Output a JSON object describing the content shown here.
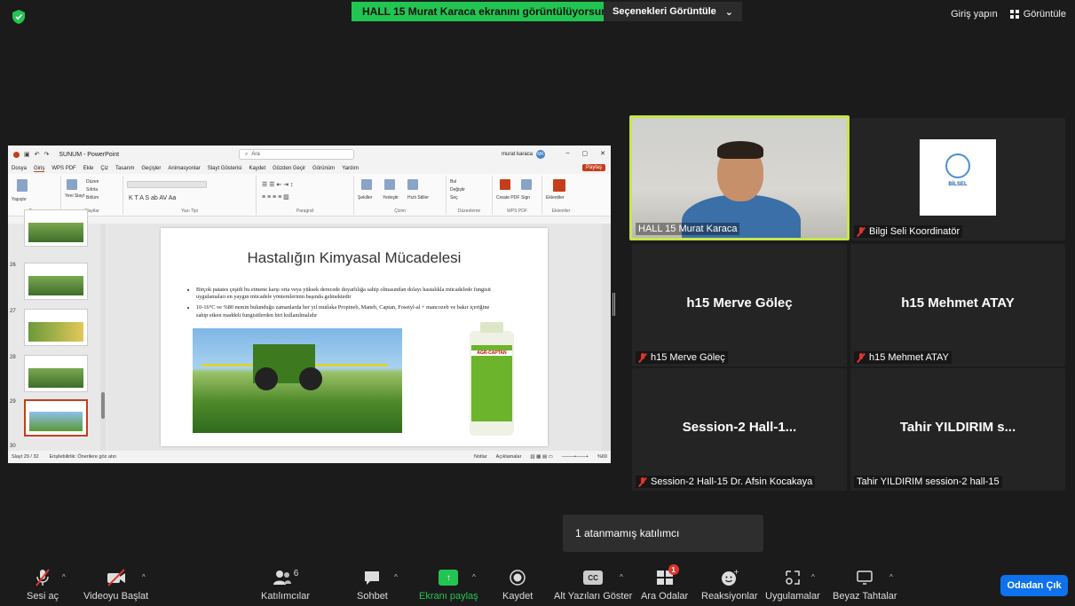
{
  "top": {
    "share_banner": "HALL 15 Murat Karaca ekranını görüntülüyorsunuz",
    "view_options": "Seçenekleri Görüntüle",
    "sign_in": "Giriş yapın",
    "view": "Görüntüle"
  },
  "ppt": {
    "doc_title": "SUNUM - PowerPoint",
    "search": "Ara",
    "user": "murat karaca",
    "user_initials": "MK",
    "share": "Paylaş",
    "menu": [
      "Dosya",
      "Giriş",
      "WPS PDF",
      "Ekle",
      "Çiz",
      "Tasarım",
      "Geçişler",
      "Animasyonlar",
      "Slayt Gösterisi",
      "Kaydet",
      "Gözden Geçir",
      "Görünüm",
      "Yardım"
    ],
    "ribbon_groups": [
      "Pano",
      "Slaytlar",
      "Yazı Tipi",
      "Paragraf",
      "Çizim",
      "Düzenleme",
      "WPS PDF",
      "Eklentiler"
    ],
    "ribbon_small": {
      "paste": "Yapıştır",
      "new_slide": "Yeni Slayt",
      "layout": "Düzen",
      "reset": "Sıfırla",
      "section": "Bölüm",
      "shapes": "Şekiller",
      "arrange": "Yerleştir",
      "quick_styles": "Hızlı Stiller",
      "find": "Bul",
      "replace": "Değiştir",
      "select": "Seç",
      "create_pdf": "Create PDF",
      "sign": "Sign",
      "addins": "Eklentiler"
    },
    "thumb_numbers": [
      "26",
      "27",
      "28",
      "29",
      "30"
    ],
    "slide": {
      "title": "Hastalığın Kimyasal Mücadelesi",
      "bullet1": "Birçok patates çeşidi bu etmene karşı orta veya yüksek derecede duyarlılığa sahip olmasından dolayı hastalıkla mücadelede fungisit uygulamaları en yaygın mücadele yöntemlerinin başında gelmektedir",
      "bullet2": "10-16°C ve %80 nemin bulunduğu zamanlarda her yıl mutlaka Propineb, Maneb, Captan, Fosetyl-al + mancozeb ve bakır içeriğine sahip etken maddeli fungisitlerden biri kullanılmalıdır",
      "bottle_label": "AGR-CAPTAN"
    },
    "status": {
      "slide_counter": "Slayt 29 / 32",
      "accessibility": "Erişilebilirlik: Önerilere göz atın",
      "notes": "Notlar",
      "comments": "Açıklamalar",
      "zoom": "%69"
    }
  },
  "tiles": [
    {
      "name": "HALL 15 Murat Karaca",
      "muted": false
    },
    {
      "name": "Bilgi Seli Koordinatör",
      "muted": true,
      "logo_text": "BİLSEL"
    },
    {
      "center": "h15 Merve Göleç",
      "name": "h15 Merve Göleç",
      "muted": true
    },
    {
      "center": "h15 Mehmet ATAY",
      "name": "h15 Mehmet ATAY",
      "muted": true
    },
    {
      "center": "Session-2  Hall-1...",
      "name": "Session-2 Hall-15 Dr. Afsin Kocakaya",
      "muted": true
    },
    {
      "center": "Tahir YILDIRIM  s...",
      "name": "Tahir YILDIRIM session-2 hall-15",
      "muted": false
    }
  ],
  "tooltip": "1 atanmamış katılımcı",
  "toolbar": {
    "unmute": "Sesi aç",
    "start_video": "Videoyu Başlat",
    "participants": "Katılımcılar",
    "participants_count": "6",
    "chat": "Sohbet",
    "share_screen": "Ekranı paylaş",
    "record": "Kaydet",
    "captions": "Alt Yazıları Göster",
    "cc": "CC",
    "breakout": "Ara Odalar",
    "breakout_badge": "1",
    "reactions": "Reaksiyonlar",
    "apps": "Uygulamalar",
    "whiteboard": "Beyaz Tahtalar",
    "leave": "Odadan Çık"
  },
  "colors": {
    "share_green": "#23c552",
    "active_speaker": "#c6e64a",
    "leave_blue": "#0e72ed",
    "mute_red": "#e0342b"
  }
}
